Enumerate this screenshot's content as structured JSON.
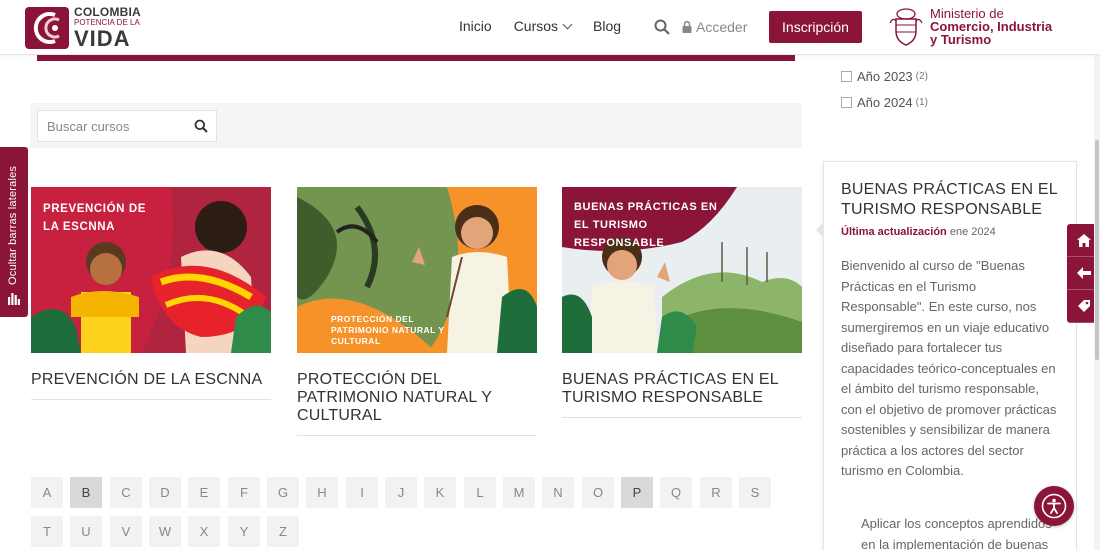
{
  "header": {
    "logo": {
      "line1": "COLOMBIA",
      "line2": "POTENCIA DE LA",
      "line3": "VIDA"
    },
    "nav": {
      "inicio": "Inicio",
      "cursos": "Cursos",
      "blog": "Blog"
    },
    "acceder": "Acceder",
    "inscripcion": "Inscripción",
    "ministerio": {
      "line1": "Ministerio de",
      "line2": "Comercio, Industria",
      "line3": "y Turismo"
    }
  },
  "search": {
    "placeholder": "Buscar cursos"
  },
  "courses": [
    {
      "title": "PREVENCIÓN DE LA ESCNNA",
      "banner": "PREVENCIÓN DE LA ESCNNA"
    },
    {
      "title": "PROTECCIÓN DEL PATRIMONIO NATURAL Y CULTURAL",
      "banner": "PROTECCIÓN DEL PATRIMONIO NATURAL Y CULTURAL"
    },
    {
      "title": "BUENAS PRÁCTICAS EN EL TURISMO RESPONSABLE",
      "banner": "BUENAS PRÁCTICAS EN EL TURISMO RESPONSABLE"
    }
  ],
  "alphabet": {
    "letters": [
      "A",
      "B",
      "C",
      "D",
      "E",
      "F",
      "G",
      "H",
      "I",
      "J",
      "K",
      "L",
      "M",
      "N",
      "O",
      "P",
      "Q",
      "R",
      "S",
      "T",
      "U",
      "V",
      "W",
      "X",
      "Y",
      "Z"
    ],
    "active": [
      "B",
      "P"
    ]
  },
  "filters": {
    "years": [
      {
        "label": "Año 2023",
        "count": "(2)"
      },
      {
        "label": "Año 2024",
        "count": "(1)"
      }
    ]
  },
  "detail": {
    "title": "BUENAS PRÁCTICAS EN EL TURISMO RESPONSABLE",
    "updated_label": "Última actualización",
    "updated_date": "ene 2024",
    "description": "Bienvenido al curso de \"Buenas Prácticas en el Turismo Responsable\". En este curso, nos sumergiremos en un viaje educativo diseñado para fortalecer tus capacidades teórico-conceptuales en el ámbito del turismo responsable, con el objetivo de promover prácticas sostenibles y sensibilizar de manera práctica a los actores del sector turismo en Colombia.",
    "bullet": "Aplicar los conceptos aprendidos en la implementación de buenas"
  },
  "side_toggle": {
    "label": "Ocultar barras laterales"
  },
  "colors": {
    "brand": "#8a1538",
    "orange": "#f5922a"
  },
  "icons": [
    "search-icon",
    "lock-icon",
    "chevron-down-icon",
    "home-icon",
    "arrow-left-icon",
    "tag-icon",
    "accessibility-icon",
    "bars-icon"
  ]
}
